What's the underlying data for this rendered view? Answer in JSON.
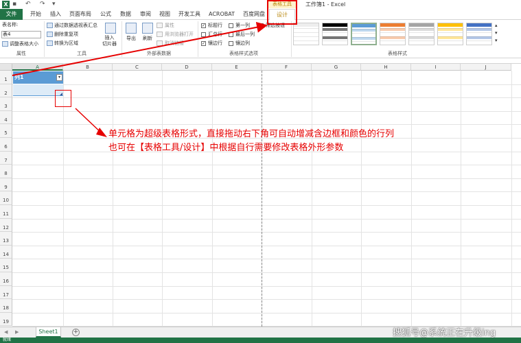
{
  "titlebar": {
    "app_logo": "X",
    "title": "工作簿1 - Excel",
    "context_label": "表格工具",
    "quick_access": [
      "save-icon",
      "undo-icon",
      "redo-icon",
      "customize-icon"
    ]
  },
  "tabs": [
    {
      "label": "文件"
    },
    {
      "label": "开始"
    },
    {
      "label": "插入"
    },
    {
      "label": "页面布局"
    },
    {
      "label": "公式"
    },
    {
      "label": "数据"
    },
    {
      "label": "审阅"
    },
    {
      "label": "视图"
    },
    {
      "label": "开发工具"
    },
    {
      "label": "ACROBAT"
    },
    {
      "label": "百度网盘"
    },
    {
      "label": "设计"
    }
  ],
  "ribbon": {
    "properties": {
      "table_name_label": "表名称:",
      "table_name_value": "表4",
      "resize_label": "调整表格大小",
      "group_label": "属性"
    },
    "tools": {
      "pivot_label": "通过数据透视表汇总",
      "dedupe_label": "删除重复项",
      "convert_label": "转换为区域",
      "slicer_label": "插入\n切片器",
      "group_label": "工具"
    },
    "external": {
      "export_label": "导出",
      "refresh_label": "刷新",
      "properties_label": "属性",
      "browser_label": "用浏览器打开",
      "unlink_label": "取消链接",
      "group_label": "外部表数据"
    },
    "style_options": {
      "header_row": "标题行",
      "first_col": "第一列",
      "filter_btn": "筛选按钮",
      "total_row": "汇总行",
      "last_col": "最后一列",
      "banded_rows": "镶边行",
      "banded_cols": "镶边列",
      "group_label": "表格样式选项"
    },
    "styles": {
      "group_label": "表格样式",
      "swatches": [
        {
          "color": "#ffffff",
          "head": "#dddddd"
        },
        {
          "color": "#404040",
          "head": "#000000"
        },
        {
          "color": "#bdd7ee",
          "head": "#5b9bd5"
        },
        {
          "color": "#f8cbad",
          "head": "#ed7d31"
        },
        {
          "color": "#dbdbdb",
          "head": "#a5a5a5"
        },
        {
          "color": "#ffe699",
          "head": "#ffc000"
        },
        {
          "color": "#b4c7e7",
          "head": "#4472c4"
        }
      ]
    }
  },
  "grid": {
    "columns": [
      "A",
      "B",
      "C",
      "D",
      "E",
      "F",
      "G",
      "H",
      "I",
      "J"
    ],
    "rows": [
      "1",
      "2",
      "3",
      "4",
      "5",
      "6",
      "7",
      "8",
      "9",
      "10",
      "11",
      "12",
      "13",
      "14",
      "15",
      "16",
      "17",
      "18",
      "19"
    ],
    "cell_a1": "列1"
  },
  "annotation": {
    "line1": "单元格为超级表格形式，直接拖动右下角可自动增减含边框和颜色的行列",
    "line2": "也可在【表格工具/设计】中根据自行需要修改表格外形参数"
  },
  "sheetbar": {
    "sheet_tab": "Sheet1",
    "add_sheet": "+"
  },
  "statusbar": {
    "status": "就绪"
  },
  "watermark": "搜狐号@系统正在升级ing"
}
